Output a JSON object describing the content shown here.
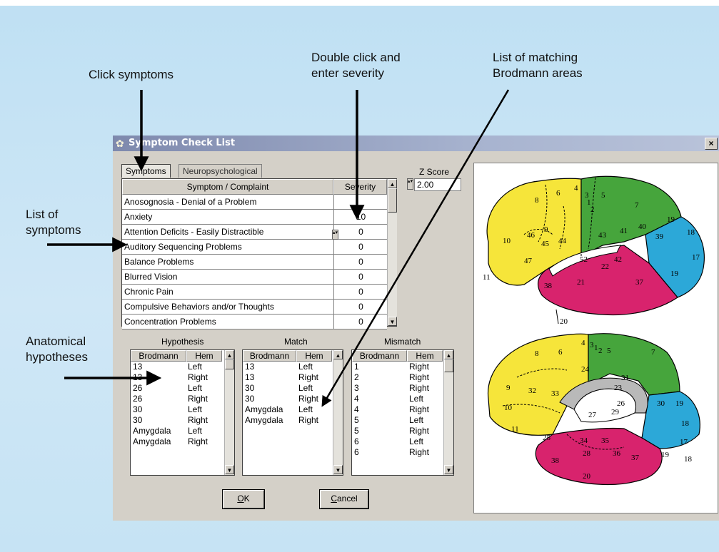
{
  "annotations": {
    "click_symptoms": "Click symptoms",
    "double_click_line1": "Double click and",
    "double_click_line2": "enter severity",
    "list_matching_line1": "List of matching",
    "list_matching_line2": "Brodmann areas",
    "list_of_line1": "List of",
    "list_of_line2": "symptoms",
    "anatomical_line1": "Anatomical",
    "anatomical_line2": "hypotheses"
  },
  "window": {
    "title": "Symptom Check List",
    "close_glyph": "×",
    "tabs": [
      "Symptoms",
      "Neuropsychological"
    ],
    "active_tab": "Symptoms"
  },
  "zscore": {
    "label": "Z Score",
    "value": "2.00"
  },
  "symptom_table": {
    "headers": [
      "Symptom / Complaint",
      "Severity"
    ],
    "rows": [
      {
        "symptom": "Anosognosia - Denial of a Problem",
        "severity": ""
      },
      {
        "symptom": "Anxiety",
        "severity": "10"
      },
      {
        "symptom": "Attention Deficits - Easily Distractible",
        "severity": "0"
      },
      {
        "symptom": "Auditory Sequencing Problems",
        "severity": "0"
      },
      {
        "symptom": "Balance Problems",
        "severity": "0"
      },
      {
        "symptom": "Blurred Vision",
        "severity": "0"
      },
      {
        "symptom": "Chronic Pain",
        "severity": "0"
      },
      {
        "symptom": "Compulsive Behaviors and/or Thoughts",
        "severity": "0"
      },
      {
        "symptom": "Concentration Problems",
        "severity": "0"
      }
    ]
  },
  "hypothesis": {
    "label": "Hypothesis",
    "headers": [
      "Brodmann",
      "Hem"
    ],
    "rows": [
      [
        "13",
        "Left"
      ],
      [
        "13",
        "Right"
      ],
      [
        "26",
        "Left"
      ],
      [
        "26",
        "Right"
      ],
      [
        "30",
        "Left"
      ],
      [
        "30",
        "Right"
      ],
      [
        "Amygdala",
        "Left"
      ],
      [
        "Amygdala",
        "Right"
      ]
    ]
  },
  "match": {
    "label": "Match",
    "headers": [
      "Brodmann",
      "Hem"
    ],
    "rows": [
      [
        "13",
        "Left"
      ],
      [
        "13",
        "Right"
      ],
      [
        "30",
        "Left"
      ],
      [
        "30",
        "Right"
      ],
      [
        "Amygdala",
        "Left"
      ],
      [
        "Amygdala",
        "Right"
      ]
    ]
  },
  "mismatch": {
    "label": "Mismatch",
    "headers": [
      "Brodmann",
      "Hem"
    ],
    "rows": [
      [
        "1",
        "Right"
      ],
      [
        "2",
        "Right"
      ],
      [
        "3",
        "Right"
      ],
      [
        "4",
        "Left"
      ],
      [
        "4",
        "Right"
      ],
      [
        "5",
        "Left"
      ],
      [
        "5",
        "Right"
      ],
      [
        "6",
        "Left"
      ],
      [
        "6",
        "Right"
      ]
    ]
  },
  "buttons": {
    "ok": "OK",
    "ok_key": "O",
    "ok_rest": "K",
    "cancel_key": "C",
    "cancel_rest": "ancel"
  },
  "scroll": {
    "up": "▲",
    "down": "▼"
  },
  "brain": {
    "lateral_labels": [
      "8",
      "6",
      "4",
      "3",
      "1",
      "2",
      "5",
      "7",
      "9",
      "46",
      "10",
      "45",
      "44",
      "43",
      "41",
      "40",
      "39",
      "19",
      "18",
      "17",
      "19",
      "47",
      "52",
      "42",
      "22",
      "11",
      "38",
      "21",
      "37",
      "20"
    ],
    "medial_labels": [
      "4",
      "3",
      "1",
      "2",
      "5",
      "6",
      "8",
      "7",
      "24",
      "31",
      "9",
      "32",
      "33",
      "23",
      "30",
      "19",
      "10",
      "26",
      "18",
      "29",
      "27",
      "11",
      "25",
      "17",
      "34",
      "35",
      "28",
      "36",
      "37",
      "19",
      "18",
      "38",
      "20"
    ]
  },
  "colors": {
    "yellow": "#f6e53a",
    "green": "#46a53c",
    "cyan": "#2ca8d8",
    "magenta": "#d8236d",
    "gray": "#b9b9b9"
  }
}
